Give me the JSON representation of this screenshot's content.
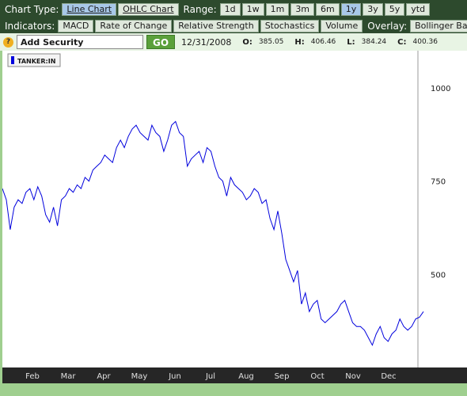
{
  "toolbar": {
    "chart_type_label": "Chart Type:",
    "chart_types": [
      "Line Chart",
      "OHLC Chart"
    ],
    "range_label": "Range:",
    "ranges": [
      "1d",
      "1w",
      "1m",
      "3m",
      "6m",
      "1y",
      "3y",
      "5y",
      "ytd"
    ],
    "selected_range": "1y",
    "indicators_label": "Indicators:",
    "indicators": [
      "MACD",
      "Rate of Change",
      "Relative Strength",
      "Stochastics",
      "Volume"
    ],
    "overlay_label": "Overlay:",
    "overlays": [
      "Bollinger Bands"
    ]
  },
  "security": {
    "help_glyph": "?",
    "input_value": "Add Security",
    "go_label": "GO"
  },
  "quote": {
    "date": "12/31/2008",
    "o_label": "O:",
    "o": "385.05",
    "h_label": "H:",
    "h": "406.46",
    "l_label": "L:",
    "l": "384.24",
    "c_label": "C:",
    "c": "400.36"
  },
  "legend": {
    "series_name": "TANKER:IN",
    "color": "#0000dd"
  },
  "colors": {
    "line": "#0000dd",
    "toolbar_bg": "#2d4a2d",
    "go_button": "#5aa03a",
    "selected_button": "#a8c8e8"
  },
  "chart_data": {
    "type": "line",
    "series": [
      {
        "name": "TANKER:IN",
        "values": [
          730,
          700,
          620,
          680,
          700,
          690,
          720,
          730,
          700,
          735,
          710,
          660,
          640,
          680,
          630,
          700,
          710,
          730,
          720,
          740,
          730,
          760,
          750,
          780,
          790,
          800,
          820,
          810,
          800,
          840,
          860,
          840,
          870,
          890,
          900,
          880,
          870,
          860,
          900,
          880,
          870,
          830,
          860,
          900,
          910,
          880,
          870,
          790,
          810,
          820,
          830,
          800,
          840,
          830,
          790,
          760,
          750,
          710,
          760,
          740,
          730,
          720,
          700,
          710,
          730,
          720,
          690,
          700,
          650,
          620,
          670,
          610,
          540,
          510,
          480,
          510,
          420,
          450,
          400,
          420,
          430,
          380,
          370,
          380,
          390,
          400,
          420,
          430,
          400,
          370,
          360,
          360,
          350,
          330,
          310,
          340,
          360,
          330,
          320,
          340,
          350,
          380,
          360,
          350,
          360,
          380,
          385,
          400
        ]
      }
    ],
    "yticks": [
      500,
      750,
      1000
    ],
    "ylim": [
      250,
      1100
    ],
    "months": [
      "Feb",
      "Mar",
      "Apr",
      "May",
      "Jun",
      "Jul",
      "Aug",
      "Sep",
      "Oct",
      "Nov",
      "Dec"
    ],
    "grid": false,
    "legend_position": "top-left"
  }
}
